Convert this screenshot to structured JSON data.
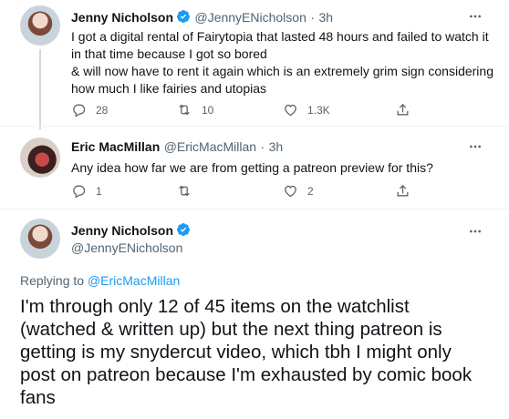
{
  "tweet1": {
    "name": "Jenny Nicholson",
    "handle": "@JennyENicholson",
    "sep": "·",
    "time": "3h",
    "lines": [
      "I got a digital rental of Fairytopia that lasted 48 hours and failed to watch it",
      "in that time because I got so bored",
      "& will now have to rent it again which is an extremely grim sign considering",
      "how much I like fairies and utopias"
    ],
    "replies": "28",
    "retweets": "10",
    "likes": "1.3K"
  },
  "tweet2": {
    "name": "Eric MacMillan",
    "handle": "@EricMacMillan",
    "sep": "·",
    "time": "3h",
    "text": "Any idea how far we are from getting a patreon preview for this?",
    "replies": "1",
    "retweets": "",
    "likes": "2"
  },
  "tweet3": {
    "name": "Jenny Nicholson",
    "handle": "@JennyENicholson",
    "replying_prefix": "Replying to",
    "replying_handle": "@EricMacMillan",
    "lines": [
      "I'm through only 12 of 45 items on the watchlist",
      "(watched & written up) but the next thing patreon is",
      "getting is my snydercut video, which tbh I might only",
      "post on patreon because I'm exhausted by comic book",
      "fans"
    ]
  },
  "colors": {
    "accent": "#1d9bf0",
    "muted": "#536471",
    "text": "#0f1419"
  },
  "icons": [
    "reply-icon",
    "retweet-icon",
    "like-icon",
    "share-icon",
    "verified-icon",
    "more-icon"
  ]
}
